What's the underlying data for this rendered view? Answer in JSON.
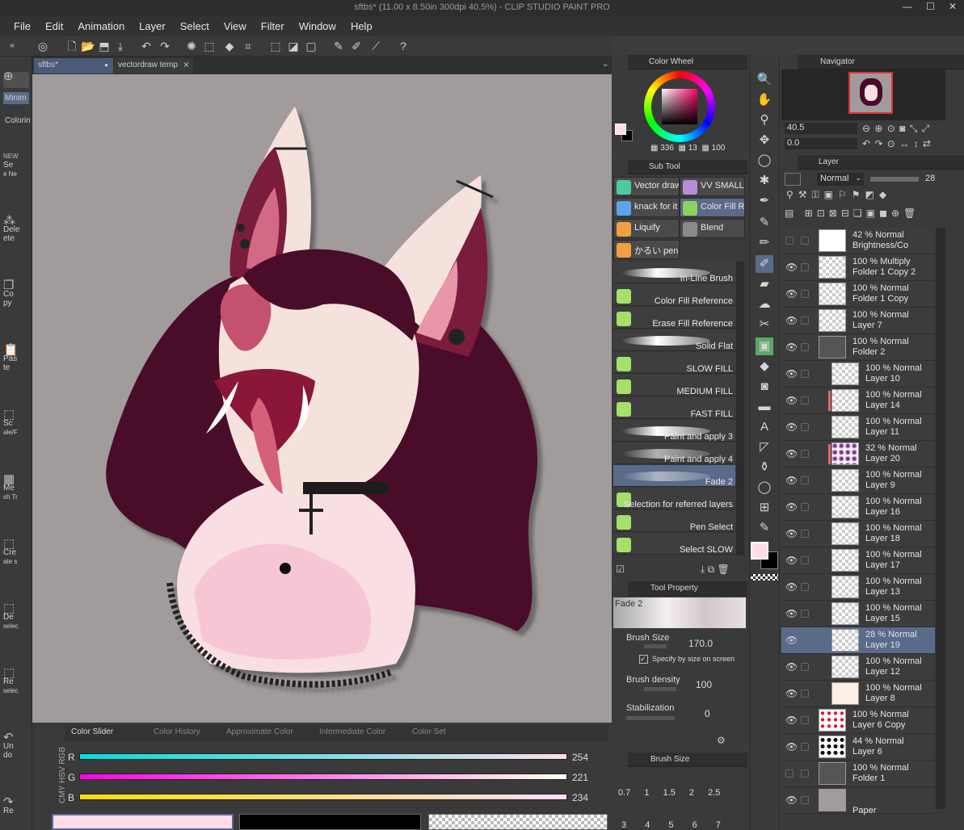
{
  "window": {
    "title": "sftbs* (11.00 x 8.50in 300dpi 40.5%) - CLIP STUDIO PAINT PRO",
    "min": "—",
    "max": "☐",
    "close": "✕"
  },
  "menu": [
    "File",
    "Edit",
    "Animation",
    "Layer",
    "Select",
    "View",
    "Filter",
    "Window",
    "Help"
  ],
  "tabs": [
    {
      "label": "sftbs*",
      "marker": "●"
    },
    {
      "label": "vectordraw temp",
      "close": "×"
    }
  ],
  "left_tools": [
    {
      "label": "Minim",
      "glyph": ""
    },
    {
      "label": "Colorin",
      "glyph": ""
    },
    {
      "label": "Se",
      "sub": "e Ne",
      "glyph": "NEW"
    },
    {
      "label": "Dele",
      "sub": "ete",
      "glyph": "⁂"
    },
    {
      "label": "Co",
      "sub": "py",
      "glyph": "❐"
    },
    {
      "label": "Pas",
      "sub": "te",
      "glyph": "📋"
    },
    {
      "label": "Sc",
      "sub": "ale/F",
      "glyph": "⬚"
    },
    {
      "label": "Me",
      "sub": "sh Tr",
      "glyph": "▦"
    },
    {
      "label": "Cre",
      "sub": "ate s",
      "glyph": "⬚"
    },
    {
      "label": "De",
      "sub": "selec",
      "glyph": "⬚"
    },
    {
      "label": "Re",
      "sub": "selec",
      "glyph": "⬚"
    },
    {
      "label": "Un",
      "sub": "do",
      "glyph": "↶"
    },
    {
      "label": "Re",
      "sub": "",
      "glyph": "↷"
    }
  ],
  "color_panel": {
    "tabs": [
      "Color Slider",
      "Color History",
      "Approximate Color",
      "Intermediate Color",
      "Color Set"
    ],
    "modes": [
      "RGB",
      "HSV",
      "CMY"
    ],
    "r": {
      "label": "R",
      "value": "254"
    },
    "g": {
      "label": "G",
      "value": "221"
    },
    "b": {
      "label": "B",
      "value": "234"
    }
  },
  "color_wheel": {
    "title": "Color Wheel",
    "h": "336",
    "s": "13",
    "v": "100",
    "main_color": "#fedde9",
    "sub_color": "#000000"
  },
  "sub_tool": {
    "title": "Sub Tool",
    "groups": [
      {
        "label": "Vector draw",
        "color": "#4ec9a0"
      },
      {
        "label": "VV SMALL",
        "color": "#b98ad6"
      },
      {
        "label": "knack for it",
        "color": "#5aa6e8"
      },
      {
        "label": "Color Fill Re",
        "color": "#8ad45c"
      },
      {
        "label": "Liquify",
        "color": "#f0a040"
      },
      {
        "label": "Blend",
        "color": "#8a8a8a"
      },
      {
        "label": "かるい pen",
        "color": "#f0a040"
      }
    ],
    "brushes": [
      "In-Line Brush",
      "Color Fill Reference",
      "Erase Fill Reference",
      "Solid Flat",
      "SLOW FILL",
      "MEDIUM FILL",
      "FAST FILL",
      "Paint and apply 3",
      "Paint and apply 4",
      "Fade 2",
      "Selection for referred layers",
      "Pen Select",
      "Select SLOW"
    ]
  },
  "tool_property": {
    "title": "Tool Property",
    "preset": "Fade 2",
    "brush_size_label": "Brush Size",
    "brush_size": "170.0",
    "specify_label": "Specify by size on screen",
    "density_label": "Brush density",
    "density": "100",
    "stab_label": "Stabilization",
    "stab": "0"
  },
  "brush_size_panel": {
    "title": "Brush Size",
    "sizes": [
      "0.7",
      "1",
      "1.5",
      "2",
      "2.5",
      "3",
      "4",
      "5",
      "6",
      "7"
    ]
  },
  "navigator": {
    "title": "Navigator",
    "zoom": "40.5",
    "rotation": "0.0"
  },
  "layer_panel": {
    "title": "Layer",
    "blend": "Normal",
    "opacity": "28",
    "layers": [
      {
        "pct": "42 % Normal",
        "name": "Brightness/Co",
        "thumb": "white",
        "eye": false
      },
      {
        "pct": "100 % Multiply",
        "name": "Folder 1 Copy 2",
        "thumb": "check",
        "eye": true
      },
      {
        "pct": "100 % Normal",
        "name": "Folder 1 Copy",
        "thumb": "check",
        "eye": true
      },
      {
        "pct": "100 % Normal",
        "name": "Layer 7",
        "thumb": "check",
        "eye": true
      },
      {
        "pct": "100 % Normal",
        "name": "Folder 2",
        "thumb": "folder",
        "eye": true
      },
      {
        "pct": "100 % Normal",
        "name": "Layer 10",
        "thumb": "check",
        "eye": true
      },
      {
        "pct": "100 % Normal",
        "name": "Layer 14",
        "thumb": "check",
        "eye": true
      },
      {
        "pct": "100 % Normal",
        "name": "Layer 11",
        "thumb": "check",
        "eye": true
      },
      {
        "pct": "32 % Normal",
        "name": "Layer 20",
        "thumb": "purple",
        "eye": true
      },
      {
        "pct": "100 % Normal",
        "name": "Layer 9",
        "thumb": "check",
        "eye": true
      },
      {
        "pct": "100 % Normal",
        "name": "Layer 16",
        "thumb": "check",
        "eye": true
      },
      {
        "pct": "100 % Normal",
        "name": "Layer 18",
        "thumb": "check",
        "eye": true
      },
      {
        "pct": "100 % Normal",
        "name": "Layer 17",
        "thumb": "check",
        "eye": true
      },
      {
        "pct": "100 % Normal",
        "name": "Layer 13",
        "thumb": "check",
        "eye": true
      },
      {
        "pct": "100 % Normal",
        "name": "Layer 15",
        "thumb": "check",
        "eye": true
      },
      {
        "pct": "28 % Normal",
        "name": "Layer 19",
        "thumb": "check",
        "eye": true,
        "selected": true
      },
      {
        "pct": "100 % Normal",
        "name": "Layer 12",
        "thumb": "check",
        "eye": true
      },
      {
        "pct": "100 % Normal",
        "name": "Layer 8",
        "thumb": "cream",
        "eye": true
      },
      {
        "pct": "100 % Normal",
        "name": "Layer 6 Copy",
        "thumb": "red",
        "eye": true
      },
      {
        "pct": "44 % Normal",
        "name": "Layer 6",
        "thumb": "black",
        "eye": true
      },
      {
        "pct": "100 % Normal",
        "name": "Folder 1",
        "thumb": "folder",
        "eye": false
      },
      {
        "pct": "",
        "name": "Paper",
        "thumb": "gray",
        "eye": true
      }
    ]
  }
}
